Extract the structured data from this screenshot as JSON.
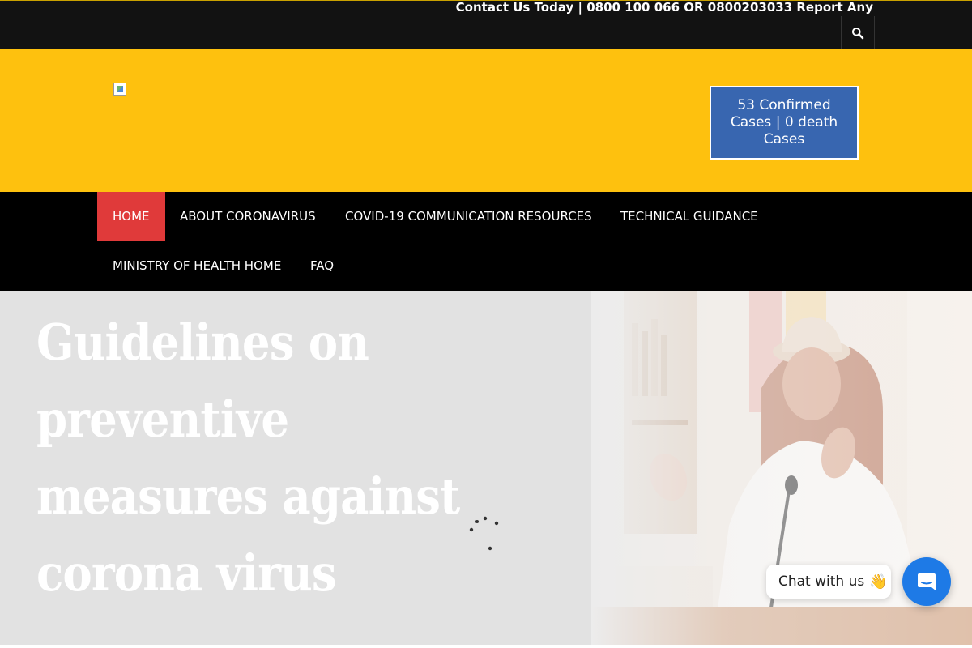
{
  "topbar": {
    "contact_text": "Contact Us Today | 0800 100 066 OR 0800203033 Report Any",
    "search_icon": "search-icon"
  },
  "header": {
    "logo_icon": "broken-image-icon",
    "cases_text": "53 Confirmed Cases | 0 death Cases",
    "band_color": "#fec10e",
    "cases_color": "#3866b0"
  },
  "nav": {
    "items": [
      {
        "label": "HOME",
        "active": true
      },
      {
        "label": "ABOUT CORONAVIRUS"
      },
      {
        "label": "COVID-19 COMMUNICATION RESOURCES"
      },
      {
        "label": "TECHNICAL GUIDANCE"
      },
      {
        "label": "MINISTRY OF HEALTH HOME"
      },
      {
        "label": "FAQ"
      }
    ],
    "active_color": "#e03a3a"
  },
  "hero": {
    "title_line1": "Guidelines on preventive",
    "title_line2": "measures against",
    "title_line3": "corona virus"
  },
  "chat": {
    "label": "Chat with us",
    "wave": "👋",
    "icon": "chat-bubble-icon",
    "color": "#1e7ae6"
  }
}
